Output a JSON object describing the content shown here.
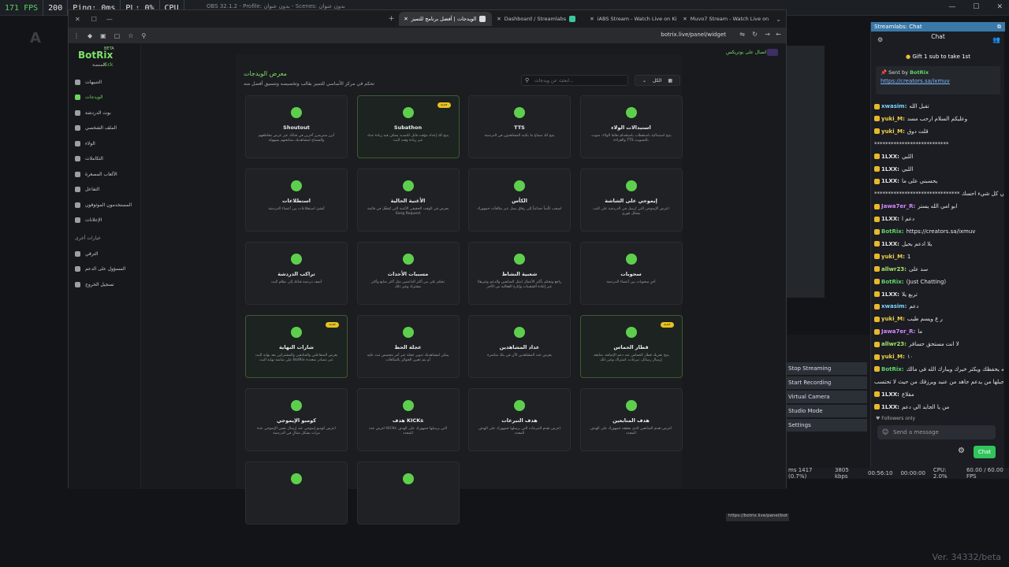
{
  "obs": {
    "fps_label": "171 FPS",
    "fps_value": "200",
    "ping": "Ping: 0ms",
    "pl": "PL: 0%",
    "cpu": "CPU",
    "title": "OBS 32.1.2 - Profile: بدون عنوان - Scenes: بدون عنوان",
    "version": "Ver. 34332/beta",
    "controls": [
      "Stop Streaming",
      "Start Recording",
      "Virtual Camera",
      "Studio Mode",
      "Settings"
    ],
    "status": {
      "frames": "ms 1417 (0.7%)",
      "bitrate": "3805 kbps",
      "time": "00:56:10",
      "rec": "00:00:00",
      "cpu": "CPU: 2.0%",
      "fps": "60.00 / 60.00 FPS"
    }
  },
  "browser": {
    "tabs": [
      {
        "label": "الويدجات | أفضل برنامج للتميز",
        "active": true
      },
      {
        "label": "Dashboard / Streamlabs",
        "active": false
      },
      {
        "label": "iABS Stream - Watch Live on Ki",
        "active": false
      },
      {
        "label": "Muvo7 Stream - Watch Live on",
        "active": false
      }
    ],
    "url": "botrix.live/panel/widget",
    "status_url": "https://botrix.live/panel/bot"
  },
  "botrix": {
    "logo": "BotRix",
    "beta": "BETA",
    "kick": "Kick",
    "header_user": "اتصال على بوتريكس",
    "sidebar_top": "المنصة",
    "sidebar": [
      {
        "label": "التنبيهات",
        "active": false
      },
      {
        "label": "الويدجات",
        "active": true
      },
      {
        "label": "بوت الدردشة",
        "active": false
      },
      {
        "label": "الملف الشخصي",
        "active": false
      },
      {
        "label": "الولاء",
        "active": false
      },
      {
        "label": "التكاملات",
        "active": false
      },
      {
        "label": "الألعاب المصغرة",
        "active": false
      },
      {
        "label": "التفاعل",
        "active": false
      },
      {
        "label": "المستخدمون الموثوقون",
        "active": false
      },
      {
        "label": "الإعلانات",
        "active": false
      }
    ],
    "sidebar_section": "خيارات أخرى",
    "sidebar_bottom": [
      "الترقي",
      "المسؤول على الدعم",
      "تسجيل الخروج"
    ],
    "main_title": "معرض الويدجات",
    "main_subtitle": "تحكم في مركز الأساسي للتميز بقالب وتخصيصه وتنسيق أفضل منه",
    "search_placeholder": "ابحث عن ويدجات...",
    "filter_label": "الكل",
    "cards": [
      {
        "title": "Shoutout",
        "desc": "أبرز ستريمرز آخرين في قناتك عبر عرض مقاطعهم والسماح لمشاهديك بمتابعتهم بسهولة",
        "badge": "",
        "hl": false,
        "icon": "megaphone-icon"
      },
      {
        "title": "Subathon",
        "desc": "يتيح لك إعداد مؤقت قابل للتمديد يضاف فيه زيادة عداد عبر زيادة وقت البث",
        "badge": "جديد",
        "hl": true,
        "icon": "clock-icon"
      },
      {
        "title": "TTS",
        "desc": "يتيح لك سماع ما يكتبه المشاهدون في الدردشة",
        "badge": "",
        "hl": false,
        "icon": "speaker-icon"
      },
      {
        "title": "استبدالات الولاء",
        "desc": "يتيح استبدالية باستقطاب باستخدام نقاط الولاء، صوت، والقراءة TTS بالتصويت",
        "badge": "",
        "hl": false,
        "icon": "trophy-icon"
      },
      {
        "title": "استطلاعات",
        "desc": "أنشئ استطلاعات بين أعضاء الدردشة",
        "badge": "",
        "hl": false,
        "icon": "poll-icon"
      },
      {
        "title": "الأغنية الحالية",
        "desc": "يعرض في الوقت الحقيقي الأغنية التي تُشغّل في قائمة Song Request",
        "badge": "",
        "hl": false,
        "icon": "music-icon"
      },
      {
        "title": "الكأس",
        "desc": "اسحب كأساً جماعياً إلى رفاق يصل عبر مكافآت جمهورك",
        "badge": "",
        "hl": false,
        "icon": "cup-icon"
      },
      {
        "title": "إيموجي على الشاشة",
        "desc": "اعرض الإيموجي التي تُرسل في الدردشة على البث بشكل فوري",
        "badge": "",
        "hl": false,
        "icon": "globe-icon"
      },
      {
        "title": "تراكب الدردشة",
        "desc": "أضف دردشة قناتك إلى نظام البث",
        "badge": "",
        "hl": false,
        "icon": "chat-icon"
      },
      {
        "title": "مسببات الأحداث",
        "desc": "تحكم على من أكثر الداعمين مثل أكثر متابع وأكثر مشترك وغير ذلك",
        "badge": "",
        "hl": false,
        "icon": "tag-icon"
      },
      {
        "title": "شعبية النشاط",
        "desc": "راجع وتحكم بأكثر الأعمال (مثل المتابعين والدعم وغيرها) عبر إعادة الشعبيات وإنارة الفعالية من الأجر",
        "badge": "",
        "hl": false,
        "icon": "board-icon"
      },
      {
        "title": "سحوبات",
        "desc": "أجرِ سحوبات بين أعضاء الدردشة",
        "badge": "",
        "hl": false,
        "icon": "gift-icon"
      },
      {
        "title": "شارات النهاية",
        "desc": "يعرض المتفاعلين والمتابعين والمشتركين بعد نهاية البث على شاشة نهاية البث BotRix عبر مصادر متعددة",
        "badge": "جديد",
        "hl": true,
        "icon": "credits-icon"
      },
      {
        "title": "عجلة الحظ",
        "desc": "يمكن لمشاهديك تدوير عجلة عبر أمر مخصص ثبت عليه أو يتم تعيين الجوائز بالمكافآت",
        "badge": "",
        "hl": false,
        "icon": "wheel-icon"
      },
      {
        "title": "عداد المشاهدين",
        "desc": "يعرض عدد المشاهدين الآن في بثك مباشرة",
        "badge": "",
        "hl": false,
        "icon": "eye-icon"
      },
      {
        "title": "قطار الحماس",
        "desc": "يتيح تحريك قطار الحماس عند دعم الإضافة، متابعة، إرسال رسائل، تبرعات، اشتراك وغير ذلك",
        "badge": "جديد",
        "hl": true,
        "icon": "train-icon"
      },
      {
        "title": "كومبو الإيموجي",
        "desc": "اعرض كومبو إيموجي عند إرسال نفس الإيموجي عدة مرات بشكل متتالٍ في الدردشة",
        "badge": "",
        "hl": false,
        "icon": "smile-icon"
      },
      {
        "title": "هدف KICKs",
        "desc": "اعرض عدد KICKs التي يرسلها جمهورك على الهدف المحدد",
        "badge": "",
        "hl": false,
        "icon": "gem-icon"
      },
      {
        "title": "هدف التبرعات",
        "desc": "اعرض تقدم التبرعات التي يرسلها جمهورك على الهدف المحدد",
        "badge": "",
        "hl": false,
        "icon": "dollar-icon"
      },
      {
        "title": "هدف المتابعين",
        "desc": "اعرض تقدم المتابعين الذي يحققه جمهورك على الهدف المحدد",
        "badge": "",
        "hl": false,
        "icon": "chart-icon"
      },
      {
        "title": "",
        "desc": "",
        "badge": "",
        "hl": false,
        "icon": "star-icon"
      },
      {
        "title": "",
        "desc": "",
        "badge": "",
        "hl": false,
        "icon": "pin-icon"
      }
    ]
  },
  "chat": {
    "panel_title": "Streamlabs: Chat",
    "title": "Chat",
    "gift": "Gift 1 sub to take 1st",
    "pinned_by": "Sent by",
    "pinned_user": "BotRix",
    "pinned_link": "https://creators.sa/ixmuv",
    "messages": [
      {
        "user": "xwasim:",
        "text": "تقبل الله",
        "color": "#7fd3ff"
      },
      {
        "user": "yuki_M:",
        "text": "وعليكم السلام ارحب مسد",
        "color": "#f0d04a"
      },
      {
        "user": "yuki_M:",
        "text": "قلت دوق",
        "color": "#f0d04a"
      },
      {
        "user": "",
        "text": "***************************",
        "color": "#ddd"
      },
      {
        "user": "1LXX:",
        "text": "اللبي",
        "color": "#e6e6e6"
      },
      {
        "user": "1LXX:",
        "text": "اللبي",
        "color": "#e6e6e6"
      },
      {
        "user": "1LXX:",
        "text": "يحسبني على ما",
        "color": "#e6e6e6"
      },
      {
        "user": "",
        "text": "******************************* مدقم ياملي كل شيء احسك",
        "color": "#ddd"
      },
      {
        "user": "Jawa7er_R:",
        "text": "ابو امي الله يستر",
        "color": "#d488ff"
      },
      {
        "user": "1LXX:",
        "text": "دعم ا",
        "color": "#e6e6e6"
      },
      {
        "user": "BotRix:",
        "text": "https://creators.sa/ixmuv",
        "color": "#5fd36b"
      },
      {
        "user": "1LXX:",
        "text": "يلا ادعم بحيل",
        "color": "#e6e6e6"
      },
      {
        "user": "yuki_M:",
        "text": "1",
        "color": "#f0d04a"
      },
      {
        "user": "allwr23:",
        "text": "سد على",
        "color": "#a5e46b"
      },
      {
        "user": "BotRix:",
        "text": "(Just Chatting)",
        "color": "#5fd36b"
      },
      {
        "user": "1LXX:",
        "text": "تربع يلا",
        "color": "#e6e6e6"
      },
      {
        "user": "xwasim:",
        "text": "دعم",
        "color": "#7fd3ff"
      },
      {
        "user": "yuki_M:",
        "text": "ر ع ويسم طيب",
        "color": "#f0d04a"
      },
      {
        "user": "Jawa7er_R:",
        "text": "ما",
        "color": "#d488ff"
      },
      {
        "user": "allwr23:",
        "text": "لا انت مستحق حسافر",
        "color": "#a5e46b"
      },
      {
        "user": "yuki_M:",
        "text": "١٠",
        "color": "#f0d04a"
      },
      {
        "user": "BotRix:",
        "text": "الله يحفظك ويكثر خيرك ويبارك الله في مالك",
        "color": "#5fd36b"
      },
      {
        "user": "",
        "text": "ويحفظك يا جبلها من يدعم جاهد من عنيد ويرزقك من حيث لا تحتسب",
        "color": "#ddd"
      },
      {
        "user": "1LXX:",
        "text": "مقلاع",
        "color": "#e6e6e6"
      },
      {
        "user": "1LXX:",
        "text": "من يا الجايد الي دعم",
        "color": "#e6e6e6"
      }
    ],
    "followers_only": "Followers only",
    "input_placeholder": "Send a message",
    "send_label": "Chat"
  }
}
